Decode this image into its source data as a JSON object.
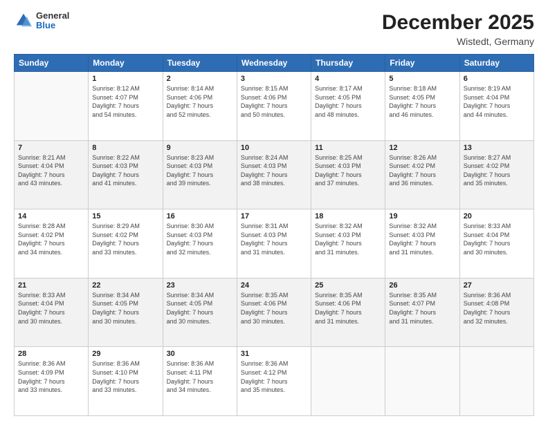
{
  "logo": {
    "general": "General",
    "blue": "Blue"
  },
  "header": {
    "month": "December 2025",
    "location": "Wistedt, Germany"
  },
  "days_of_week": [
    "Sunday",
    "Monday",
    "Tuesday",
    "Wednesday",
    "Thursday",
    "Friday",
    "Saturday"
  ],
  "weeks": [
    [
      {
        "num": "",
        "info": ""
      },
      {
        "num": "1",
        "info": "Sunrise: 8:12 AM\nSunset: 4:07 PM\nDaylight: 7 hours\nand 54 minutes."
      },
      {
        "num": "2",
        "info": "Sunrise: 8:14 AM\nSunset: 4:06 PM\nDaylight: 7 hours\nand 52 minutes."
      },
      {
        "num": "3",
        "info": "Sunrise: 8:15 AM\nSunset: 4:06 PM\nDaylight: 7 hours\nand 50 minutes."
      },
      {
        "num": "4",
        "info": "Sunrise: 8:17 AM\nSunset: 4:05 PM\nDaylight: 7 hours\nand 48 minutes."
      },
      {
        "num": "5",
        "info": "Sunrise: 8:18 AM\nSunset: 4:05 PM\nDaylight: 7 hours\nand 46 minutes."
      },
      {
        "num": "6",
        "info": "Sunrise: 8:19 AM\nSunset: 4:04 PM\nDaylight: 7 hours\nand 44 minutes."
      }
    ],
    [
      {
        "num": "7",
        "info": "Sunrise: 8:21 AM\nSunset: 4:04 PM\nDaylight: 7 hours\nand 43 minutes."
      },
      {
        "num": "8",
        "info": "Sunrise: 8:22 AM\nSunset: 4:03 PM\nDaylight: 7 hours\nand 41 minutes."
      },
      {
        "num": "9",
        "info": "Sunrise: 8:23 AM\nSunset: 4:03 PM\nDaylight: 7 hours\nand 39 minutes."
      },
      {
        "num": "10",
        "info": "Sunrise: 8:24 AM\nSunset: 4:03 PM\nDaylight: 7 hours\nand 38 minutes."
      },
      {
        "num": "11",
        "info": "Sunrise: 8:25 AM\nSunset: 4:03 PM\nDaylight: 7 hours\nand 37 minutes."
      },
      {
        "num": "12",
        "info": "Sunrise: 8:26 AM\nSunset: 4:02 PM\nDaylight: 7 hours\nand 36 minutes."
      },
      {
        "num": "13",
        "info": "Sunrise: 8:27 AM\nSunset: 4:02 PM\nDaylight: 7 hours\nand 35 minutes."
      }
    ],
    [
      {
        "num": "14",
        "info": "Sunrise: 8:28 AM\nSunset: 4:02 PM\nDaylight: 7 hours\nand 34 minutes."
      },
      {
        "num": "15",
        "info": "Sunrise: 8:29 AM\nSunset: 4:02 PM\nDaylight: 7 hours\nand 33 minutes."
      },
      {
        "num": "16",
        "info": "Sunrise: 8:30 AM\nSunset: 4:03 PM\nDaylight: 7 hours\nand 32 minutes."
      },
      {
        "num": "17",
        "info": "Sunrise: 8:31 AM\nSunset: 4:03 PM\nDaylight: 7 hours\nand 31 minutes."
      },
      {
        "num": "18",
        "info": "Sunrise: 8:32 AM\nSunset: 4:03 PM\nDaylight: 7 hours\nand 31 minutes."
      },
      {
        "num": "19",
        "info": "Sunrise: 8:32 AM\nSunset: 4:03 PM\nDaylight: 7 hours\nand 31 minutes."
      },
      {
        "num": "20",
        "info": "Sunrise: 8:33 AM\nSunset: 4:04 PM\nDaylight: 7 hours\nand 30 minutes."
      }
    ],
    [
      {
        "num": "21",
        "info": "Sunrise: 8:33 AM\nSunset: 4:04 PM\nDaylight: 7 hours\nand 30 minutes."
      },
      {
        "num": "22",
        "info": "Sunrise: 8:34 AM\nSunset: 4:05 PM\nDaylight: 7 hours\nand 30 minutes."
      },
      {
        "num": "23",
        "info": "Sunrise: 8:34 AM\nSunset: 4:05 PM\nDaylight: 7 hours\nand 30 minutes."
      },
      {
        "num": "24",
        "info": "Sunrise: 8:35 AM\nSunset: 4:06 PM\nDaylight: 7 hours\nand 30 minutes."
      },
      {
        "num": "25",
        "info": "Sunrise: 8:35 AM\nSunset: 4:06 PM\nDaylight: 7 hours\nand 31 minutes."
      },
      {
        "num": "26",
        "info": "Sunrise: 8:35 AM\nSunset: 4:07 PM\nDaylight: 7 hours\nand 31 minutes."
      },
      {
        "num": "27",
        "info": "Sunrise: 8:36 AM\nSunset: 4:08 PM\nDaylight: 7 hours\nand 32 minutes."
      }
    ],
    [
      {
        "num": "28",
        "info": "Sunrise: 8:36 AM\nSunset: 4:09 PM\nDaylight: 7 hours\nand 33 minutes."
      },
      {
        "num": "29",
        "info": "Sunrise: 8:36 AM\nSunset: 4:10 PM\nDaylight: 7 hours\nand 33 minutes."
      },
      {
        "num": "30",
        "info": "Sunrise: 8:36 AM\nSunset: 4:11 PM\nDaylight: 7 hours\nand 34 minutes."
      },
      {
        "num": "31",
        "info": "Sunrise: 8:36 AM\nSunset: 4:12 PM\nDaylight: 7 hours\nand 35 minutes."
      },
      {
        "num": "",
        "info": ""
      },
      {
        "num": "",
        "info": ""
      },
      {
        "num": "",
        "info": ""
      }
    ]
  ]
}
